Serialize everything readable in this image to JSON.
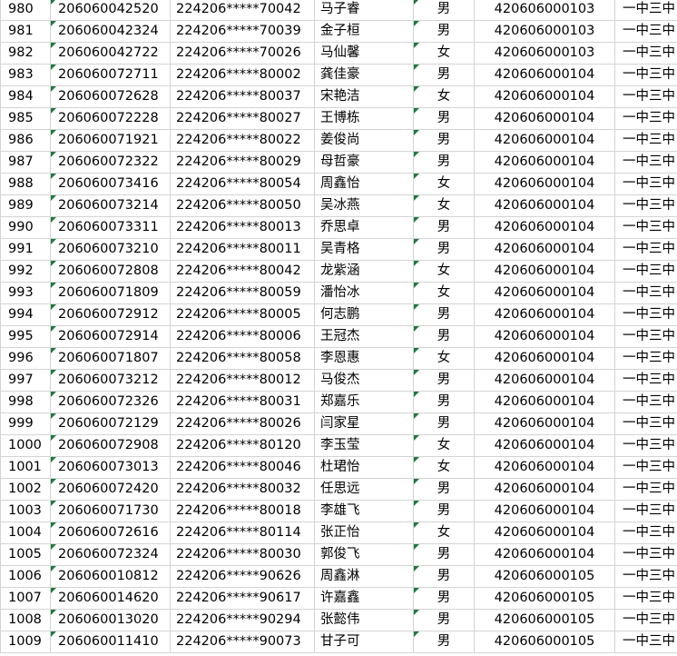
{
  "rows": [
    {
      "row": "980",
      "exam_no": "206060042520",
      "id_no": "224206*****70042",
      "name": "马子睿",
      "sex": "男",
      "school_code": "420606000103",
      "school": "一中三中"
    },
    {
      "row": "981",
      "exam_no": "206060042324",
      "id_no": "224206*****70039",
      "name": "金子桓",
      "sex": "男",
      "school_code": "420606000103",
      "school": "一中三中"
    },
    {
      "row": "982",
      "exam_no": "206060042722",
      "id_no": "224206*****70026",
      "name": "马仙馨",
      "sex": "女",
      "school_code": "420606000103",
      "school": "一中三中"
    },
    {
      "row": "983",
      "exam_no": "206060072711",
      "id_no": "224206*****80002",
      "name": "龚佳豪",
      "sex": "男",
      "school_code": "420606000104",
      "school": "一中三中"
    },
    {
      "row": "984",
      "exam_no": "206060072628",
      "id_no": "224206*****80037",
      "name": "宋艳洁",
      "sex": "女",
      "school_code": "420606000104",
      "school": "一中三中"
    },
    {
      "row": "985",
      "exam_no": "206060072228",
      "id_no": "224206*****80027",
      "name": "王博栋",
      "sex": "男",
      "school_code": "420606000104",
      "school": "一中三中"
    },
    {
      "row": "986",
      "exam_no": "206060071921",
      "id_no": "224206*****80022",
      "name": "姜俊尚",
      "sex": "男",
      "school_code": "420606000104",
      "school": "一中三中"
    },
    {
      "row": "987",
      "exam_no": "206060072322",
      "id_no": "224206*****80029",
      "name": "母哲豪",
      "sex": "男",
      "school_code": "420606000104",
      "school": "一中三中"
    },
    {
      "row": "988",
      "exam_no": "206060073416",
      "id_no": "224206*****80054",
      "name": "周鑫怡",
      "sex": "女",
      "school_code": "420606000104",
      "school": "一中三中"
    },
    {
      "row": "989",
      "exam_no": "206060073214",
      "id_no": "224206*****80050",
      "name": "吴冰燕",
      "sex": "女",
      "school_code": "420606000104",
      "school": "一中三中"
    },
    {
      "row": "990",
      "exam_no": "206060073311",
      "id_no": "224206*****80013",
      "name": "乔思卓",
      "sex": "男",
      "school_code": "420606000104",
      "school": "一中三中"
    },
    {
      "row": "991",
      "exam_no": "206060073210",
      "id_no": "224206*****80011",
      "name": "吴青格",
      "sex": "男",
      "school_code": "420606000104",
      "school": "一中三中"
    },
    {
      "row": "992",
      "exam_no": "206060072808",
      "id_no": "224206*****80042",
      "name": "龙紫涵",
      "sex": "女",
      "school_code": "420606000104",
      "school": "一中三中"
    },
    {
      "row": "993",
      "exam_no": "206060071809",
      "id_no": "224206*****80059",
      "name": "潘怡冰",
      "sex": "女",
      "school_code": "420606000104",
      "school": "一中三中"
    },
    {
      "row": "994",
      "exam_no": "206060072912",
      "id_no": "224206*****80005",
      "name": "何志鹏",
      "sex": "男",
      "school_code": "420606000104",
      "school": "一中三中"
    },
    {
      "row": "995",
      "exam_no": "206060072914",
      "id_no": "224206*****80006",
      "name": "王冠杰",
      "sex": "男",
      "school_code": "420606000104",
      "school": "一中三中"
    },
    {
      "row": "996",
      "exam_no": "206060071807",
      "id_no": "224206*****80058",
      "name": "李恩惠",
      "sex": "女",
      "school_code": "420606000104",
      "school": "一中三中"
    },
    {
      "row": "997",
      "exam_no": "206060073212",
      "id_no": "224206*****80012",
      "name": "马俊杰",
      "sex": "男",
      "school_code": "420606000104",
      "school": "一中三中"
    },
    {
      "row": "998",
      "exam_no": "206060072326",
      "id_no": "224206*****80031",
      "name": "郑嘉乐",
      "sex": "男",
      "school_code": "420606000104",
      "school": "一中三中"
    },
    {
      "row": "999",
      "exam_no": "206060072129",
      "id_no": "224206*****80026",
      "name": "闫家星",
      "sex": "男",
      "school_code": "420606000104",
      "school": "一中三中"
    },
    {
      "row": "1000",
      "exam_no": "206060072908",
      "id_no": "224206*****80120",
      "name": "李玉莹",
      "sex": "女",
      "school_code": "420606000104",
      "school": "一中三中"
    },
    {
      "row": "1001",
      "exam_no": "206060073013",
      "id_no": "224206*****80046",
      "name": "杜珺怡",
      "sex": "女",
      "school_code": "420606000104",
      "school": "一中三中"
    },
    {
      "row": "1002",
      "exam_no": "206060072420",
      "id_no": "224206*****80032",
      "name": "任思远",
      "sex": "男",
      "school_code": "420606000104",
      "school": "一中三中"
    },
    {
      "row": "1003",
      "exam_no": "206060071730",
      "id_no": "224206*****80018",
      "name": "李雄飞",
      "sex": "男",
      "school_code": "420606000104",
      "school": "一中三中"
    },
    {
      "row": "1004",
      "exam_no": "206060072616",
      "id_no": "224206*****80114",
      "name": "张正怡",
      "sex": "女",
      "school_code": "420606000104",
      "school": "一中三中"
    },
    {
      "row": "1005",
      "exam_no": "206060072324",
      "id_no": "224206*****80030",
      "name": "郭俊飞",
      "sex": "男",
      "school_code": "420606000104",
      "school": "一中三中"
    },
    {
      "row": "1006",
      "exam_no": "206060010812",
      "id_no": "224206*****90626",
      "name": "周鑫淋",
      "sex": "男",
      "school_code": "420606000105",
      "school": "一中三中"
    },
    {
      "row": "1007",
      "exam_no": "206060014620",
      "id_no": "224206*****90617",
      "name": "许嘉鑫",
      "sex": "男",
      "school_code": "420606000105",
      "school": "一中三中"
    },
    {
      "row": "1008",
      "exam_no": "206060013020",
      "id_no": "224206*****90294",
      "name": "张懿伟",
      "sex": "男",
      "school_code": "420606000105",
      "school": "一中三中"
    },
    {
      "row": "1009",
      "exam_no": "206060011410",
      "id_no": "224206*****90073",
      "name": "甘子可",
      "sex": "男",
      "school_code": "420606000105",
      "school": "一中三中"
    }
  ],
  "colors": {
    "grid_line": "#d4d4d4",
    "error_indicator": "#1e7a3c"
  }
}
